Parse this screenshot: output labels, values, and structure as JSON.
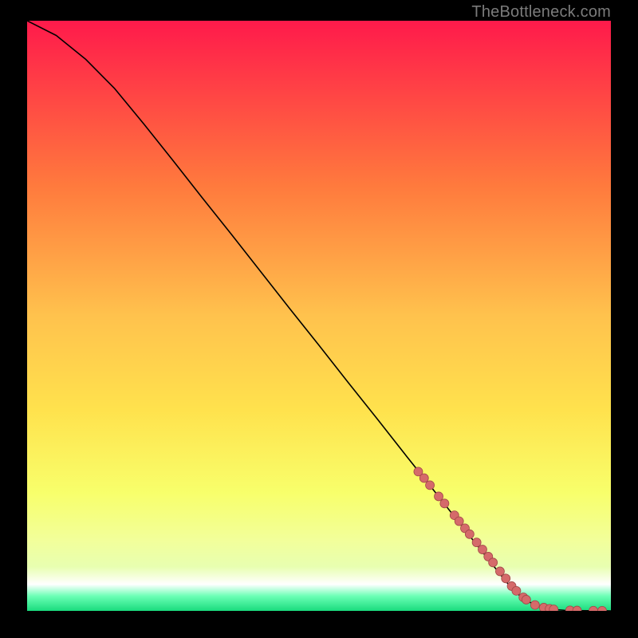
{
  "watermark": "TheBottleneck.com",
  "colors": {
    "bg_black": "#000000",
    "grad_top": "#ff1a4b",
    "grad_yellow": "#ffe24d",
    "grad_lemon": "#f8ff6b",
    "grad_pale": "#e8ffb0",
    "grad_white": "#ffffff",
    "grad_mint": "#6bffb5",
    "grad_green": "#1adb7d",
    "curve": "#000000",
    "marker_fill": "#d56a6a",
    "marker_stroke": "#a24848",
    "watermark": "#7b7b7b"
  },
  "chart_data": {
    "type": "line",
    "title": "",
    "xlabel": "",
    "ylabel": "",
    "xlim": [
      0,
      100
    ],
    "ylim": [
      0,
      100
    ],
    "grid": false,
    "legend": false,
    "annotations": [],
    "series": [
      {
        "name": "curve",
        "x": [
          0,
          5,
          10,
          15,
          20,
          25,
          30,
          35,
          40,
          45,
          50,
          55,
          60,
          65,
          70,
          75,
          80,
          82,
          84,
          86,
          88,
          90,
          92,
          94,
          96,
          98,
          100
        ],
        "y": [
          100,
          97.5,
          93.5,
          88.5,
          82.5,
          76.3,
          70,
          63.8,
          57.5,
          51.2,
          45,
          38.7,
          32.5,
          26.2,
          20,
          13.7,
          7.5,
          5,
          2.9,
          1.5,
          0.7,
          0.25,
          0.1,
          0.05,
          0.03,
          0.02,
          0.0
        ]
      },
      {
        "name": "markers",
        "x": [
          67,
          68,
          69,
          70.5,
          71.5,
          73.2,
          74,
          75,
          75.8,
          77,
          78,
          79,
          79.8,
          81,
          82,
          83,
          83.8,
          85,
          85.5,
          87,
          88.5,
          89.5,
          90.2,
          93,
          94.2,
          97,
          98.5
        ],
        "y": [
          23.6,
          22.5,
          21.3,
          19.4,
          18.2,
          16.2,
          15.2,
          14,
          13,
          11.6,
          10.4,
          9.2,
          8.2,
          6.7,
          5.5,
          4.2,
          3.4,
          2.3,
          1.9,
          1.0,
          0.55,
          0.35,
          0.25,
          0.08,
          0.06,
          0.03,
          0.02
        ]
      }
    ]
  }
}
